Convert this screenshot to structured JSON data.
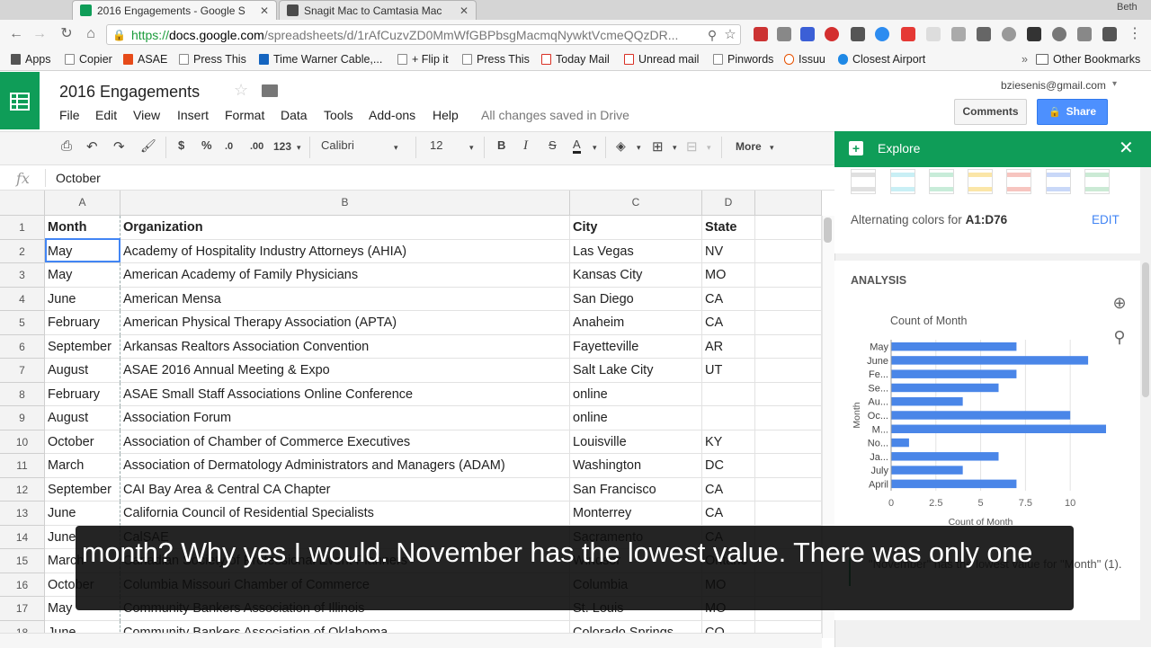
{
  "browser": {
    "tabs": [
      {
        "title": "2016 Engagements - Google S",
        "icon": "sheets-icon",
        "color": "#0f9d58",
        "active": true
      },
      {
        "title": "Snagit Mac to Camtasia Mac",
        "icon": "snagit-icon",
        "color": "#4a4a4a",
        "active": false
      }
    ],
    "profile": "Beth",
    "url": {
      "scheme": "https://",
      "host": "docs.google.com",
      "path": "/spreadsheets/d/1rAfCuzvZD0MmWfGBPbsgMacmqNywktVcmeQQzDR..."
    },
    "bookmarks": [
      "Apps",
      "Copier",
      "ASAE",
      "Press This",
      "Time Warner Cable,...",
      "+ Flip it",
      "Press This",
      "Today Mail",
      "Unread mail",
      "Pinwords",
      "Issuu",
      "Closest Airport"
    ],
    "bookmarks_more": "»",
    "other_bookmarks": "Other Bookmarks"
  },
  "sheets": {
    "title": "2016 Engagements",
    "menu": [
      "File",
      "Edit",
      "View",
      "Insert",
      "Format",
      "Data",
      "Tools",
      "Add-ons",
      "Help"
    ],
    "save_status": "All changes saved in Drive",
    "user_email": "bziesenis@gmail.com",
    "comments_label": "Comments",
    "share_label": "Share",
    "toolbar": {
      "currency": "$",
      "percent": "%",
      "dec_less": ".0",
      "dec_more": ".00",
      "number_format": "123",
      "font": "Calibri",
      "font_size": "12",
      "bold": "B",
      "italic": "I",
      "strike": "S",
      "text_color": "A",
      "more": "More"
    },
    "formula_label": "fx",
    "formula_value": "October"
  },
  "grid": {
    "columns": [
      "A",
      "B",
      "C",
      "D"
    ],
    "rows": [
      {
        "n": "1",
        "cells": [
          "Month",
          "Organization",
          "City",
          "State"
        ]
      },
      {
        "n": "2",
        "cells": [
          "May",
          "Academy of Hospitality Industry Attorneys (AHIA)",
          "Las Vegas",
          "NV"
        ]
      },
      {
        "n": "3",
        "cells": [
          "May",
          "American Academy of Family Physicians",
          "Kansas City",
          "MO"
        ]
      },
      {
        "n": "4",
        "cells": [
          "June",
          "American Mensa",
          "San Diego",
          "CA"
        ]
      },
      {
        "n": "5",
        "cells": [
          "February",
          "American Physical Therapy Association (APTA)",
          "Anaheim",
          "CA"
        ]
      },
      {
        "n": "6",
        "cells": [
          "September",
          "Arkansas Realtors Association Convention",
          "Fayetteville",
          "AR"
        ]
      },
      {
        "n": "7",
        "cells": [
          "August",
          "ASAE 2016 Annual Meeting & Expo",
          "Salt Lake City",
          "UT"
        ]
      },
      {
        "n": "8",
        "cells": [
          "February",
          "ASAE Small Staff Associations Online Conference",
          "online",
          ""
        ]
      },
      {
        "n": "9",
        "cells": [
          "August",
          "Association Forum",
          "online",
          ""
        ]
      },
      {
        "n": "10",
        "cells": [
          "October",
          "Association of Chamber of Commerce Executives",
          "Louisville",
          "KY"
        ]
      },
      {
        "n": "11",
        "cells": [
          "March",
          "Association of Dermatology Administrators and Managers (ADAM)",
          "Washington",
          "DC"
        ]
      },
      {
        "n": "12",
        "cells": [
          "September",
          "CAI Bay Area & Central CA Chapter",
          "San Francisco",
          "CA"
        ]
      },
      {
        "n": "13",
        "cells": [
          "June",
          "California Council of Residential Specialists",
          "Monterrey",
          "CA"
        ]
      },
      {
        "n": "14",
        "cells": [
          "June",
          "CalSAE",
          "Sacramento",
          "CA"
        ]
      },
      {
        "n": "15",
        "cells": [
          "March",
          "Canadian Society of Professional Event Planners",
          "Windsor",
          "Ontario"
        ]
      },
      {
        "n": "16",
        "cells": [
          "October",
          "Columbia Missouri Chamber of Commerce",
          "Columbia",
          "MO"
        ]
      },
      {
        "n": "17",
        "cells": [
          "May",
          "Community Bankers Association of Illinois",
          "St. Louis",
          "MO"
        ]
      },
      {
        "n": "18",
        "cells": [
          "June",
          "Community Bankers Association of Oklahoma",
          "Colorado Springs",
          "CO"
        ]
      }
    ]
  },
  "explore": {
    "title": "Explore",
    "swatch_colors": [
      "#e0e0e0",
      "#c9eff5",
      "#c8ecd9",
      "#fbe6a8",
      "#f7c5c0",
      "#c9d8f8",
      "#cbead5"
    ],
    "alt_colors_label": "Alternating colors for",
    "alt_colors_range": "A1:D76",
    "edit_label": "EDIT",
    "analysis_title": "ANALYSIS",
    "insight_text": "\"November\" has the lowest value for \"Month\" (1)."
  },
  "chart_data": {
    "type": "bar",
    "orientation": "horizontal",
    "title": "Count of Month",
    "xlabel": "Count of Month",
    "ylabel": "Month",
    "categories": [
      "May",
      "June",
      "Fe...",
      "Se...",
      "Au...",
      "Oc...",
      "M...",
      "No...",
      "Ja...",
      "July",
      "April"
    ],
    "values": [
      7,
      11,
      7,
      6,
      4,
      10,
      12,
      1,
      6,
      4,
      7
    ],
    "xlim": [
      0,
      12
    ],
    "xticks": [
      "0",
      "2.5",
      "5",
      "7.5",
      "10"
    ],
    "color": "#4a86e8",
    "grid": true
  },
  "caption": "month? Why yes I would. November has the lowest value. There was only one"
}
